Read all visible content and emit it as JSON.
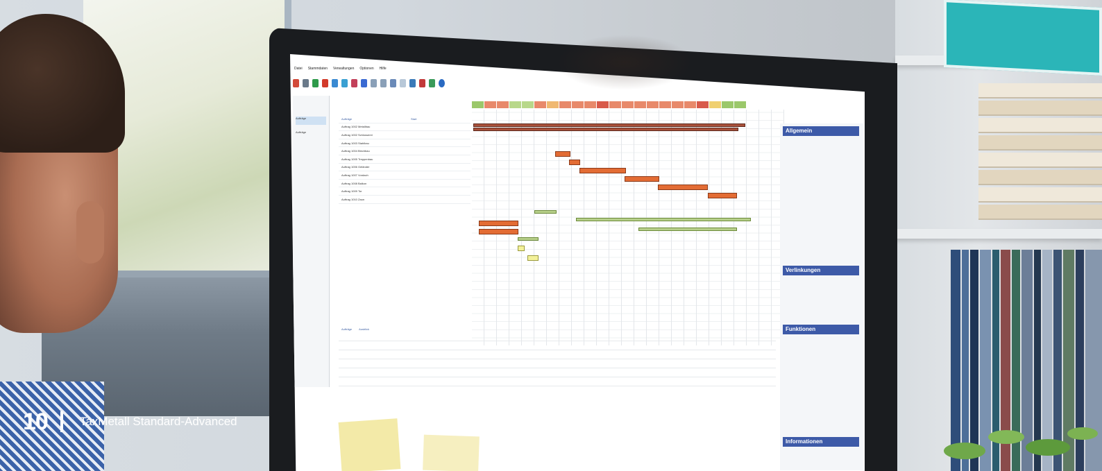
{
  "caption": {
    "page_number": "10",
    "title": "TaxMetall Standard-Advanced"
  },
  "app": {
    "menu": [
      "Datei",
      "Stammdaten",
      "Verwaltungen",
      "Optionen",
      "Hilfe"
    ],
    "sidebar": [
      "Aufträge",
      "Aufträge"
    ],
    "tree_header": [
      "Aufträge",
      "Start"
    ],
    "tree_rows": [
      [
        "Auftrag 1002 Metallbau",
        "",
        ""
      ],
      [
        "Auftrag 1002 Schlosserei",
        "",
        ""
      ],
      [
        "Auftrag 1003 Stahlbau",
        "",
        ""
      ],
      [
        "Auftrag 1004 Blechbau",
        "",
        ""
      ],
      [
        "Auftrag 1005 Treppenbau",
        "",
        ""
      ],
      [
        "Auftrag 1006 Geländer",
        "",
        ""
      ],
      [
        "Auftrag 1007 Vordach",
        "",
        ""
      ],
      [
        "Auftrag 1008 Balkon",
        "",
        ""
      ],
      [
        "Auftrag 1009 Tor",
        "",
        ""
      ],
      [
        "Auftrag 1010 Zaun",
        "",
        ""
      ]
    ],
    "right_panel": {
      "section1": "Allgemein",
      "section2": "Verlinkungen",
      "section3": "Funktionen",
      "section4": "Informationen"
    },
    "bottom_tabs": [
      "Aufträge",
      "Ausblick"
    ]
  }
}
